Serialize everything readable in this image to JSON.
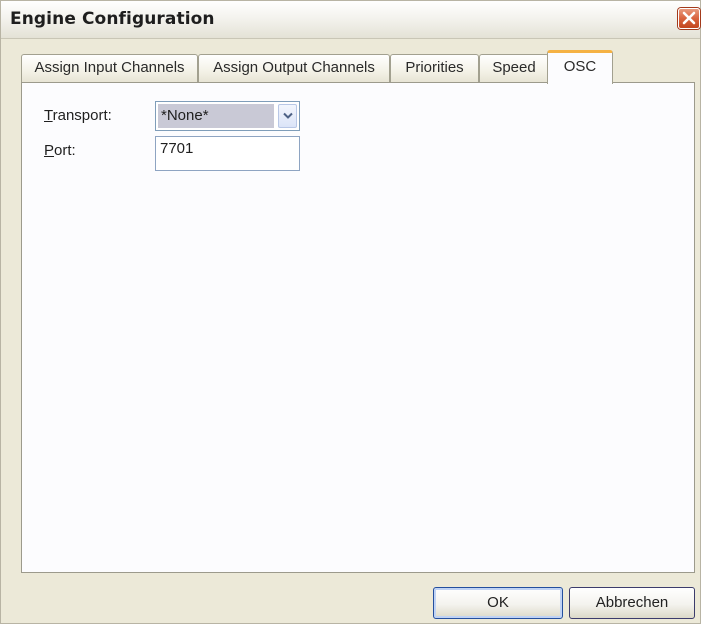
{
  "window": {
    "title": "Engine Configuration",
    "close_icon": "close-icon"
  },
  "tabs": [
    {
      "label": "Assign Input Channels",
      "active": false
    },
    {
      "label": "Assign Output Channels",
      "active": false
    },
    {
      "label": "Priorities",
      "active": false
    },
    {
      "label": "Speed",
      "active": false
    },
    {
      "label": "OSC",
      "active": true
    }
  ],
  "osc": {
    "transport_label": "Transport:",
    "transport_mnemonic": "T",
    "transport_rest": "ransport:",
    "transport_value": "*None*",
    "port_label": "Port:",
    "port_mnemonic": "P",
    "port_rest": "ort:",
    "port_value": "7701"
  },
  "buttons": {
    "ok": "OK",
    "cancel": "Abbrechen"
  },
  "colors": {
    "active_tab_accent": "#f5b244",
    "close_button": "#d9633e",
    "button_border": "#244f9e"
  }
}
